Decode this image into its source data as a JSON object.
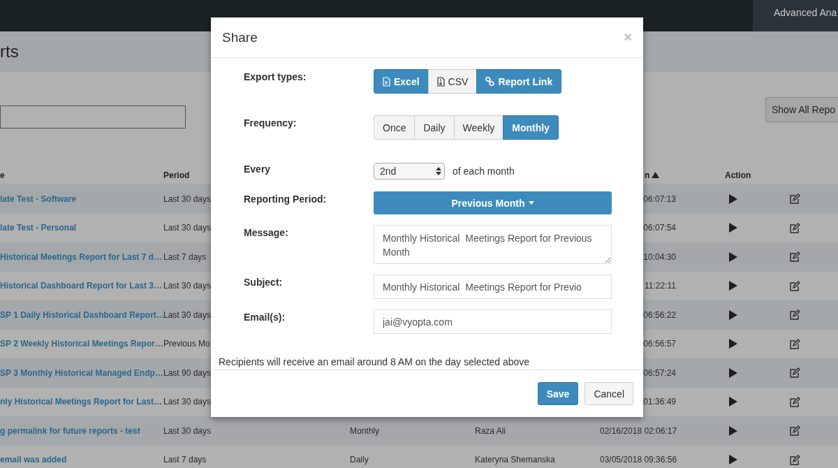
{
  "top_bar": {
    "tab": "Advanced Ana"
  },
  "page": {
    "title": "rts",
    "show_all_button": "Show All Repo"
  },
  "table": {
    "columns": [
      {
        "label": "e",
        "sorted": false
      },
      {
        "label": "Period",
        "sorted": false
      },
      {
        "label": "n",
        "sorted": true
      },
      {
        "label": "Action",
        "sorted": false
      }
    ],
    "rows": [
      {
        "name": "late Test - Software",
        "period": "Last 30 days",
        "date": "06:07:13"
      },
      {
        "name": "late Test - Personal",
        "period": "Last 30 days",
        "date": "06:07:54"
      },
      {
        "name": "Historical Meetings Report for Last 7 d…",
        "period": "Last 7 days",
        "date": "10:04:30"
      },
      {
        "name": "Historical Dashboard Report for Last 3…",
        "period": "Last 30 days",
        "date": "11:22:11"
      },
      {
        "name": "SP 1 Daily Historical Dashboard Report…",
        "period": "Last 30 days",
        "date": "06:56:22"
      },
      {
        "name": "SP 2 Weekly Historical Meetings Repor…",
        "period": "Previous Mo",
        "date": "06:56:57"
      },
      {
        "name": "SP 3 Monthly Historical Managed Endp…",
        "period": "Last 90 days",
        "date": "06:57:24"
      },
      {
        "name": "nly Historical Meetings Report for Last…",
        "period": "Last 30 days",
        "date": "01:36:49"
      },
      {
        "name": "g permalink for future reports - test",
        "period": "Last 30 days",
        "frequency": "Monthly",
        "owner": "Raza Ali",
        "date": "02/16/2018 02:06:17"
      },
      {
        "name": "email was added",
        "period": "Last 7 days",
        "frequency": "Daily",
        "owner": "Kateryna Shemanska",
        "date": "03/05/2018 09:36:56"
      }
    ]
  },
  "modal": {
    "title": "Share",
    "close": "×",
    "rows": [
      {
        "kind": "buttons",
        "label": "Export types:",
        "options": [
          {
            "label": "Excel",
            "selected": true
          },
          {
            "label": "CSV",
            "selected": false
          },
          {
            "label": "Report Link",
            "selected": true
          }
        ]
      },
      {
        "kind": "buttons",
        "label": "Frequency:",
        "options": [
          {
            "label": "Once",
            "selected": false
          },
          {
            "label": "Daily",
            "selected": false
          },
          {
            "label": "Weekly",
            "selected": false
          },
          {
            "label": "Monthly",
            "selected": true
          }
        ]
      },
      {
        "kind": "select",
        "label": "Every",
        "value": "2nd",
        "suffix": "of each month"
      },
      {
        "kind": "dropdown",
        "label": "Reporting Period:",
        "value": "Previous Month"
      },
      {
        "kind": "textarea",
        "label": "Message:",
        "value": "Monthly Historical  Meetings Report for Previous Month"
      },
      {
        "kind": "input",
        "label": "Subject:",
        "value": "Monthly Historical  Meetings Report for Previo"
      },
      {
        "kind": "input",
        "label": "Email(s):",
        "value": "jai@vyopta.com"
      }
    ],
    "note": "Recipients will receive an email around 8 AM on the day selected above",
    "buttons": [
      {
        "label": "Save",
        "kind": "primary"
      },
      {
        "label": "Cancel",
        "kind": "default"
      }
    ]
  }
}
